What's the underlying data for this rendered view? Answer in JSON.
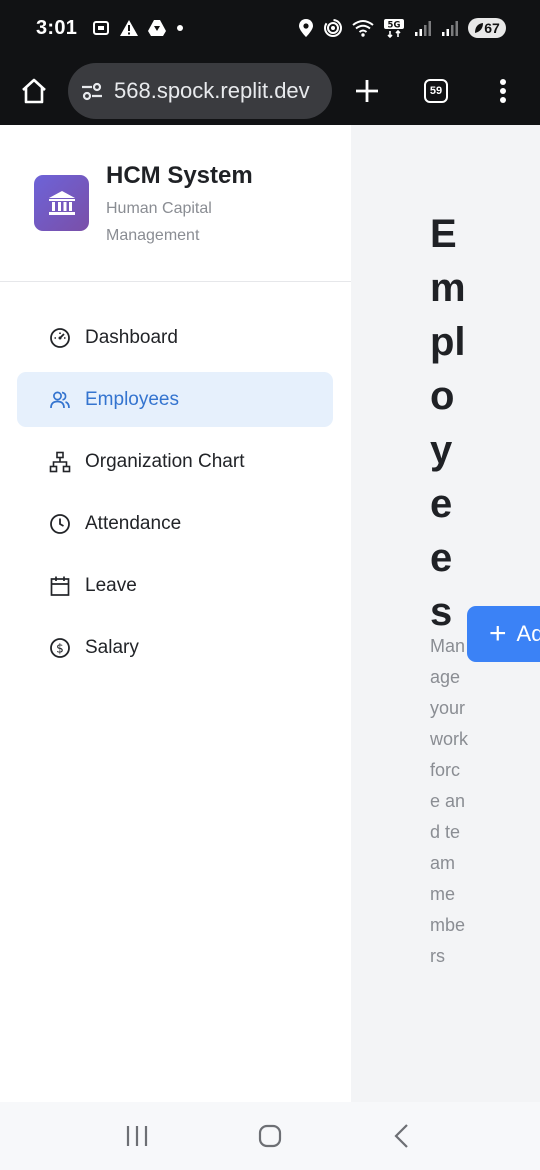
{
  "status_bar": {
    "time": "3:01",
    "battery": "67"
  },
  "browser": {
    "url": "568.spock.replit.dev",
    "tab_count": "59"
  },
  "sidebar": {
    "brand_title": "HCM System",
    "brand_subtitle": "Human Capital Management",
    "items": [
      {
        "label": "Dashboard",
        "icon": "dashboard-icon",
        "active": false
      },
      {
        "label": "Employees",
        "icon": "employees-icon",
        "active": true
      },
      {
        "label": "Organization Chart",
        "icon": "org-chart-icon",
        "active": false
      },
      {
        "label": "Attendance",
        "icon": "clock-icon",
        "active": false
      },
      {
        "label": "Leave",
        "icon": "calendar-icon",
        "active": false
      },
      {
        "label": "Salary",
        "icon": "dollar-icon",
        "active": false
      }
    ]
  },
  "main": {
    "title": "Employees",
    "subtitle": "Manage your workforce and team members",
    "add_button_label": "Ad"
  },
  "colors": {
    "accent": "#3b82f6",
    "active_bg": "#e6f0fc",
    "active_text": "#3474cf",
    "brand_logo": "#6d63d8"
  }
}
